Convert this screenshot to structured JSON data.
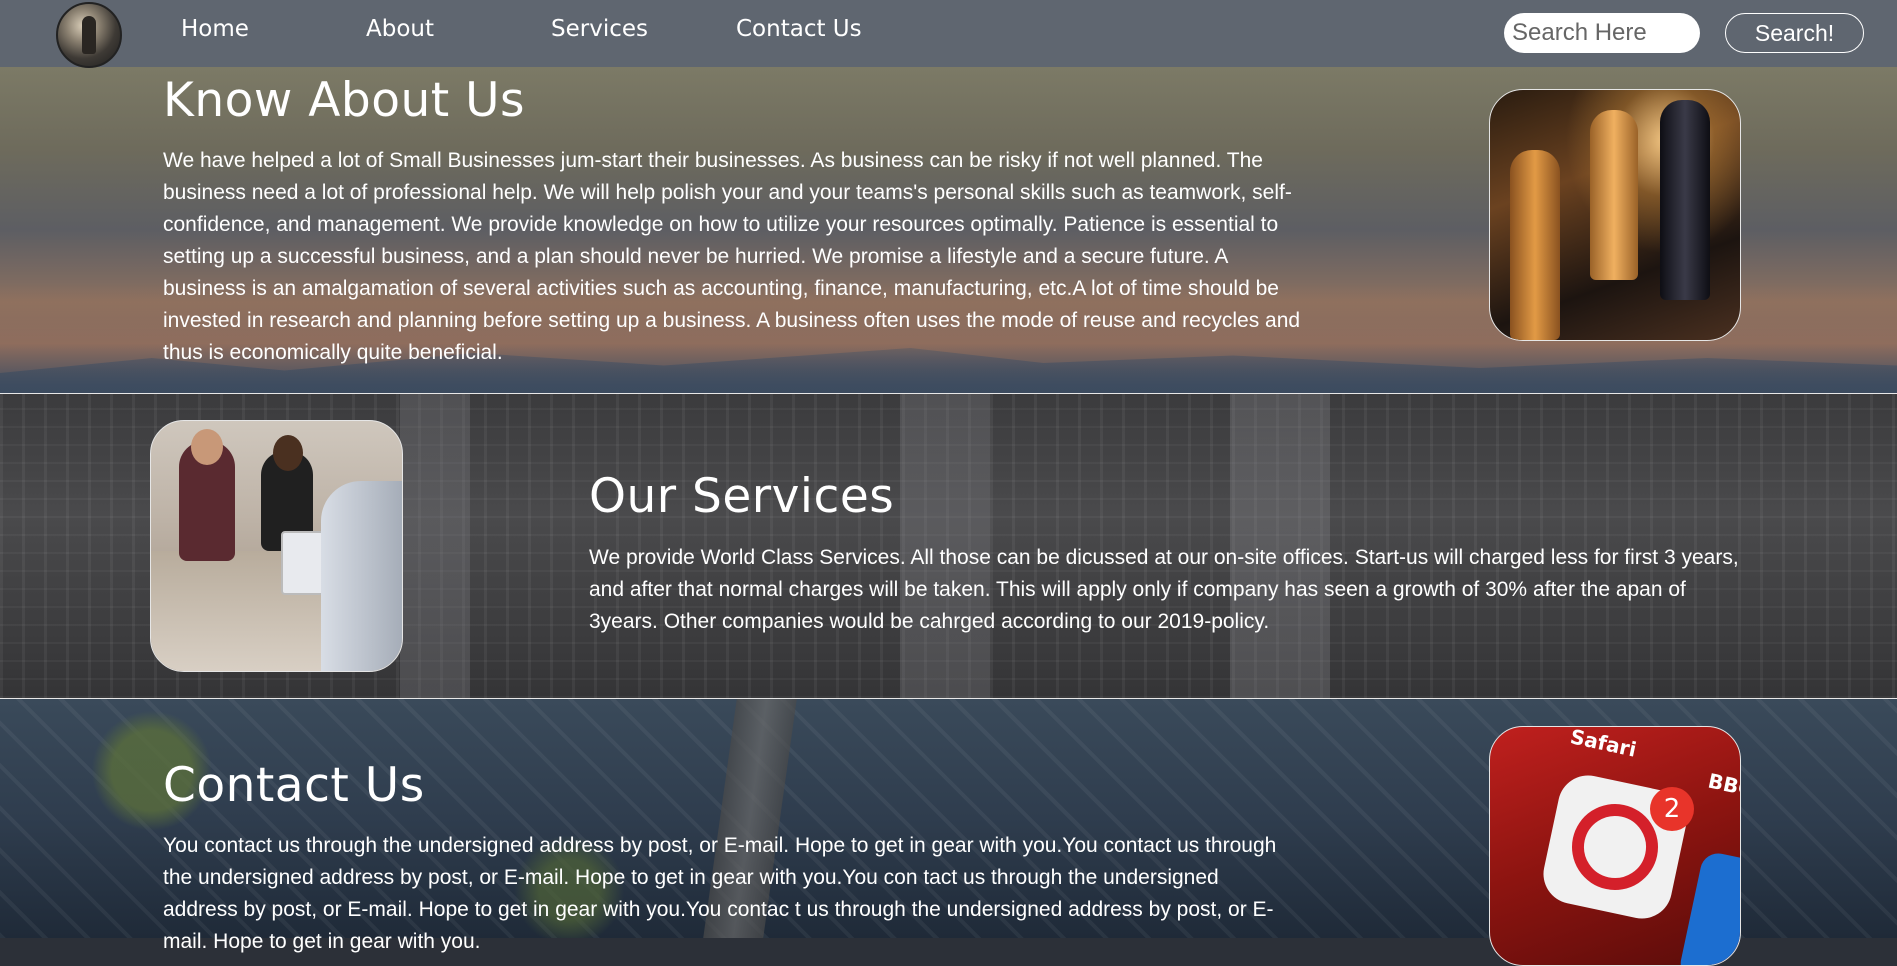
{
  "nav": {
    "links": [
      "Home",
      "About",
      "Services",
      "Contact Us"
    ],
    "search_placeholder": "Search Here",
    "search_button": "Search!"
  },
  "about": {
    "title": "Know About Us",
    "text": "We have helped a lot of Small Businesses jum-start their businesses. As business can be risky if not well planned. The business need a lot of professional help. We will help polish your and your teams's personal skills such as teamwork, self-confidence, and management. We provide knowledge on how to utilize your resources optimally. Patience is essential to setting up a successful business, and a plan should never be hurried. We promise a lifestyle and a secure future. A business is an amalgamation of several activities such as accounting, finance, manufacturing, etc.A lot of time should be invested in research and planning before setting up a business. A business often uses the mode of reuse and recycles and thus is economically quite beneficial."
  },
  "services": {
    "title": "Our Services",
    "text": "We provide World Class Services. All those can be dicussed at our on-site offices. Start-us will charged less for first 3 years, and after that normal charges will be taken. This will apply only if company has seen a growth of 30% after the apan of 3years. Other companies would be cahrged according to our 2019-policy."
  },
  "contact": {
    "title": "Contact Us",
    "text": "You contact us through the undersigned address by post, or E-mail. Hope to get in gear with you.You contact us through the undersigned address by post, or E-mail. Hope to get in gear with you.You con tact us through the undersigned address by post, or E-mail. Hope to get in gear with you.You contac t us through the undersigned address by post, or E-mail. Hope to get in gear with you."
  },
  "images": {
    "phone_safari": "Safari",
    "phone_bbc": "BBC",
    "phone_badge": "2"
  }
}
